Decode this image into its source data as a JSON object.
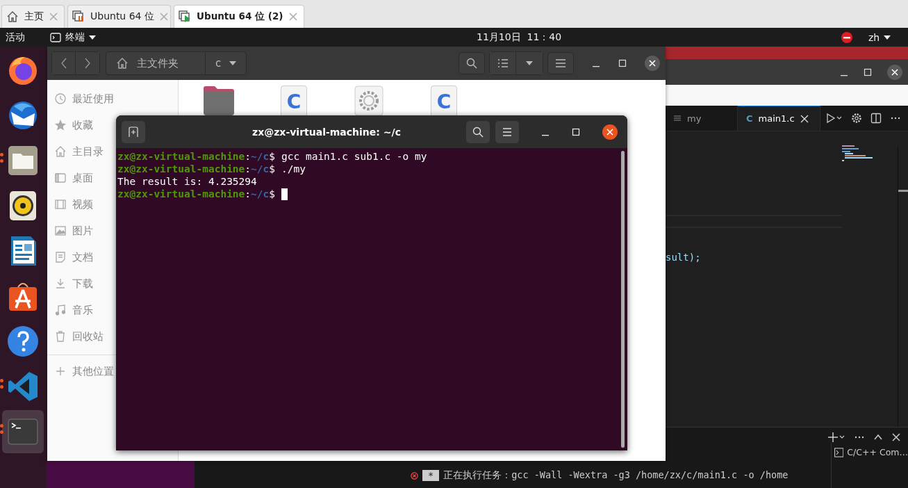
{
  "browser_tabs": [
    {
      "label": "主页",
      "kind": "home",
      "selected": false
    },
    {
      "label": "Ubuntu 64 位",
      "kind": "vm-stopped",
      "selected": false
    },
    {
      "label": "Ubuntu 64 位 (2)",
      "kind": "vm-running",
      "selected": true
    }
  ],
  "top_bar": {
    "activities": "活动",
    "app_menu": "终端",
    "clock": "11月10日  11：40",
    "language": "zh"
  },
  "dock": [
    {
      "kind": "firefox",
      "running": false,
      "selected": false
    },
    {
      "kind": "mail",
      "running": false,
      "selected": false
    },
    {
      "kind": "files",
      "running": true,
      "selected": false
    },
    {
      "kind": "music",
      "running": false,
      "selected": false
    },
    {
      "kind": "writer",
      "running": false,
      "selected": false
    },
    {
      "kind": "store",
      "running": false,
      "selected": false
    },
    {
      "kind": "help",
      "running": false,
      "selected": false
    },
    {
      "kind": "code",
      "running": true,
      "selected": false
    },
    {
      "kind": "terminal",
      "running": true,
      "selected": true
    }
  ],
  "file_manager": {
    "path": [
      {
        "label": "主文件夹",
        "kind": "home"
      },
      {
        "label": "c",
        "kind": "current"
      }
    ],
    "sidebar": [
      {
        "label": "最近使用",
        "kind": "recent"
      },
      {
        "label": "收藏",
        "kind": "starred"
      },
      {
        "label": "主目录",
        "kind": "home"
      },
      {
        "label": "桌面",
        "kind": "desktop"
      },
      {
        "label": "视频",
        "kind": "videos"
      },
      {
        "label": "图片",
        "kind": "pictures"
      },
      {
        "label": "文档",
        "kind": "documents"
      },
      {
        "label": "下载",
        "kind": "downloads"
      },
      {
        "label": "音乐",
        "kind": "music"
      },
      {
        "label": "回收站",
        "kind": "trash"
      }
    ],
    "other_places": "其他位置",
    "files": [
      {
        "kind": "folder"
      },
      {
        "kind": "c-source",
        "badge": "C"
      },
      {
        "kind": "config"
      },
      {
        "kind": "c-source",
        "badge": "C"
      }
    ]
  },
  "terminal": {
    "title": "zx@zx-virtual-machine: ~/c",
    "lines": [
      {
        "kind": "prompt",
        "host": "zx@zx-virtual-machine",
        "sep": ":",
        "path": "~/c",
        "symbol": "$",
        "command": "gcc main1.c sub1.c -o my"
      },
      {
        "kind": "prompt",
        "host": "zx@zx-virtual-machine",
        "sep": ":",
        "path": "~/c",
        "symbol": "$",
        "command": "./my"
      },
      {
        "kind": "output",
        "text": "The result is: 4.235294"
      },
      {
        "kind": "prompt",
        "host": "zx@zx-virtual-machine",
        "sep": ":",
        "path": "~/c",
        "symbol": "$",
        "cursor": true
      }
    ]
  },
  "editor": {
    "tabs": [
      {
        "label": "my",
        "kind": "text",
        "selected": false
      },
      {
        "label": "main1.c",
        "kind": "c",
        "badge": "C",
        "selected": true
      }
    ],
    "code_line": "sult);",
    "panel": {
      "terminals": [
        {
          "label": "C/C++ Com…"
        }
      ],
      "task": {
        "status": "*",
        "text": "正在执行任务：gcc -Wall -Wextra -g3 /home/zx/c/main1.c -o /home"
      }
    }
  }
}
